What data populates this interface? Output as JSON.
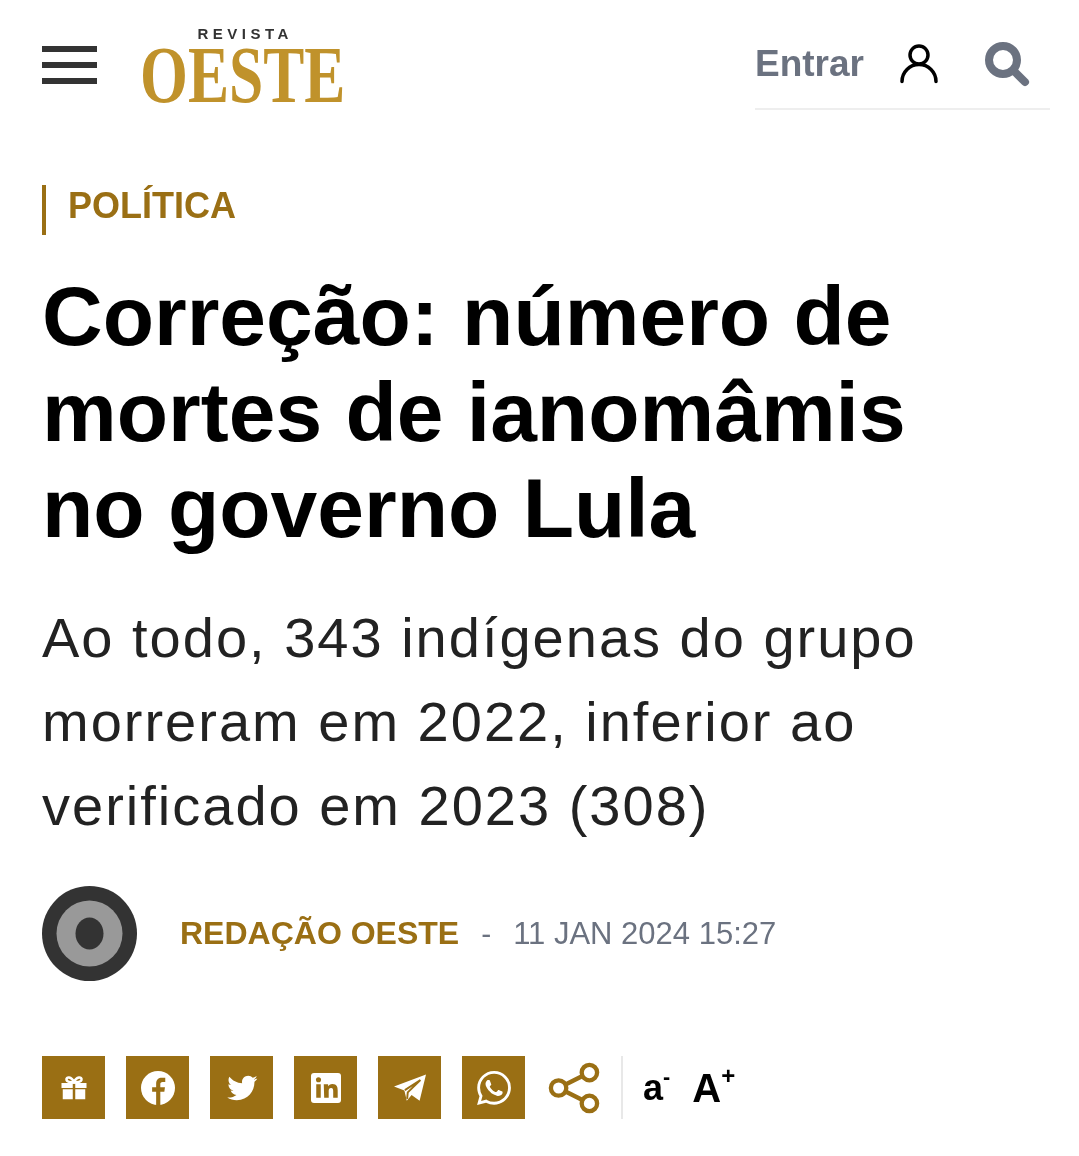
{
  "header": {
    "logo": {
      "kicker": "REVISTA",
      "wordmark": "OESTE"
    },
    "login": "Entrar"
  },
  "article": {
    "category": "POLÍTICA",
    "title": "Correção: número de mortes de ianomâmis no governo Lula",
    "subtitle": "Ao todo, 343 indígenas do grupo morreram em 2022, inferior ao verificado em 2023 (308)",
    "byline": {
      "author": "REDAÇÃO OESTE",
      "separator": "-",
      "date": "11 JAN 2024 15:27"
    }
  },
  "font_size_controls": [
    "a$^{-}$",
    "A$^{+}$"
  ]
}
